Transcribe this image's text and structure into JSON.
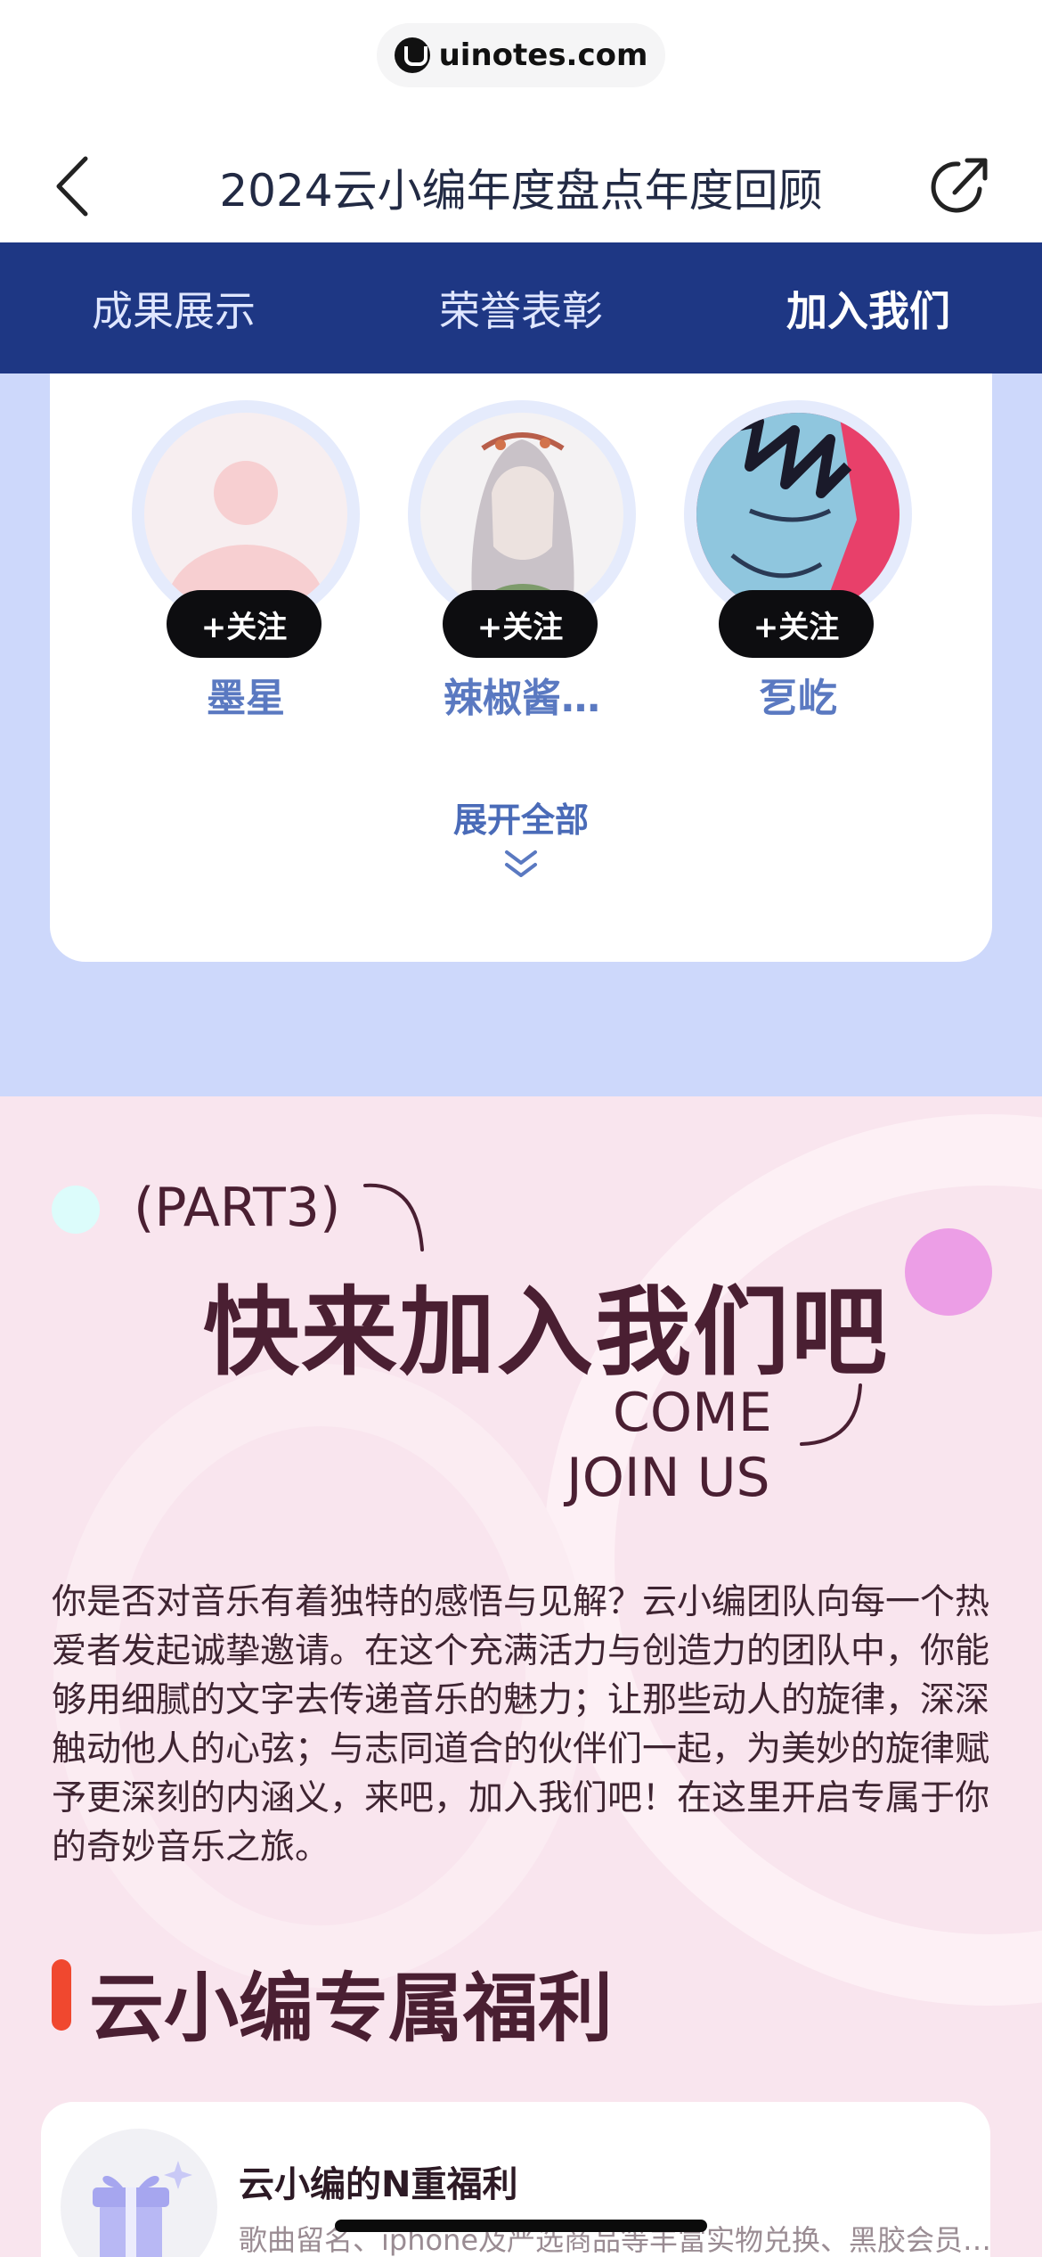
{
  "browser": {
    "url": "uinotes.com"
  },
  "header": {
    "title": "2024云小编年度盘点年度回顾"
  },
  "tabs": [
    {
      "label": "成果展示",
      "active": false
    },
    {
      "label": "荣誉表彰",
      "active": false
    },
    {
      "label": "加入我们",
      "active": true
    }
  ],
  "members": [
    {
      "name": "墨星",
      "follow_label": "+关注",
      "avatar": "default-avatar"
    },
    {
      "name": "辣椒酱…",
      "follow_label": "+关注",
      "avatar": "girl-illustration-avatar"
    },
    {
      "name": "乭屹",
      "follow_label": "+关注",
      "avatar": "boy-illustration-avatar"
    }
  ],
  "expand": {
    "label": "展开全部",
    "icon": "double-chevron-down-icon"
  },
  "part3": {
    "part_label": "(PART3)",
    "title": "快来加入我们吧",
    "subtitle_line1": "COME",
    "subtitle_line2": "JOIN US",
    "intro": "你是否对音乐有着独特的感悟与见解？云小编团队向每一个热爱者发起诚挚邀请。在这个充满活力与创造力的团队中，你能够用细腻的文字去传递音乐的魅力；让那些动人的旋律，深深触动他人的心弦；与志同道合的伙伴们一起，为美妙的旋律赋予更深刻的内涵义，来吧，加入我们吧！在这里开启专属于你的奇妙音乐之旅。"
  },
  "benefits": {
    "section_title": "云小编专属福利",
    "items": [
      {
        "title": "云小编的N重福利",
        "desc": "歌曲留名、iphone及严选商品等丰富实物兑换、黑胶会员…",
        "icon": "gift-icon"
      }
    ]
  },
  "colors": {
    "tab_bar": "#1e3784",
    "blue_bg": "#cdd8fb",
    "pink_bg": "#f9e5ee",
    "title_brown": "#4a1f32",
    "accent_red": "#f0482f",
    "member_name": "#5a79c1"
  }
}
